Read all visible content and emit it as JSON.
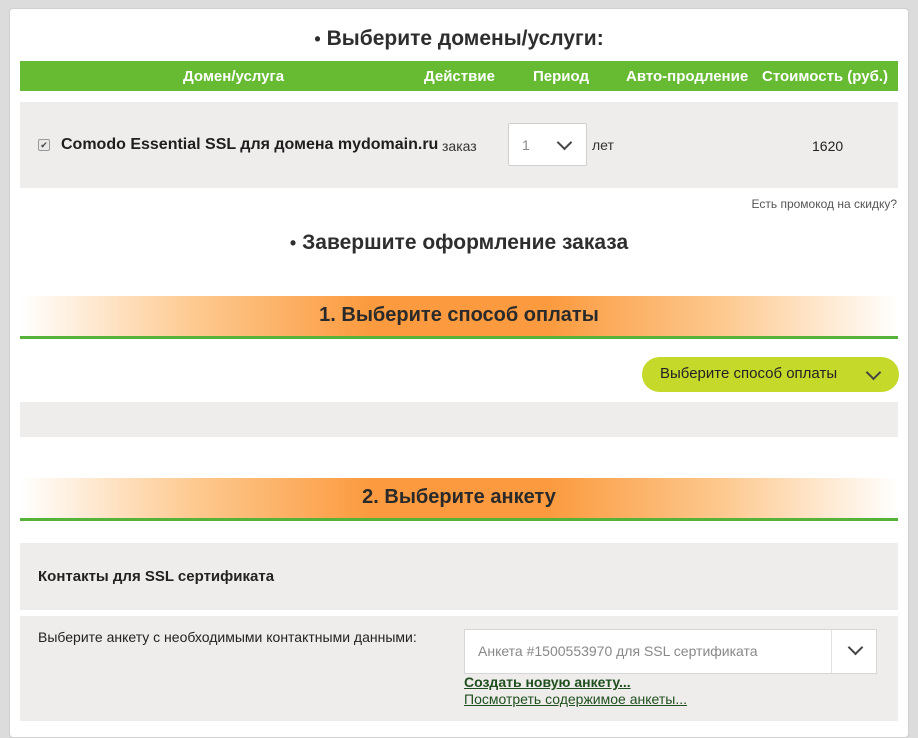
{
  "domains": {
    "heading": "Выберите домены/услуги:",
    "columns": [
      "Домен/услуга",
      "Действие",
      "Период",
      "Авто-продление",
      "Стоимость (руб.)"
    ],
    "row": {
      "checked_mark": "✔",
      "service": "Comodo Essential SSL для домена mydomain.ru",
      "action": "заказ",
      "period": "1",
      "period_unit": "лет",
      "cost": "1620"
    },
    "promo_link": "Есть промокод на скидку?"
  },
  "checkout": {
    "heading": "Завершите оформление заказа",
    "step1": "1. Выберите способ оплаты",
    "payment_button": "Выберите способ оплаты",
    "step2": "2. Выберите анкету",
    "contacts_title": "Контакты для SSL сертификата",
    "choose_label": "Выберите анкету с необходимыми контактными данными:",
    "profile_selected": "Анкета #1500553970 для SSL сертификата",
    "create_link": "Создать новую анкету...",
    "view_link": "Посмотреть содержимое анкеты..."
  },
  "colors": {
    "header_green": "#66bb33",
    "accent_lime": "#c5d92a",
    "orange": "#fb9a3e",
    "row_grey": "#efedeb"
  }
}
